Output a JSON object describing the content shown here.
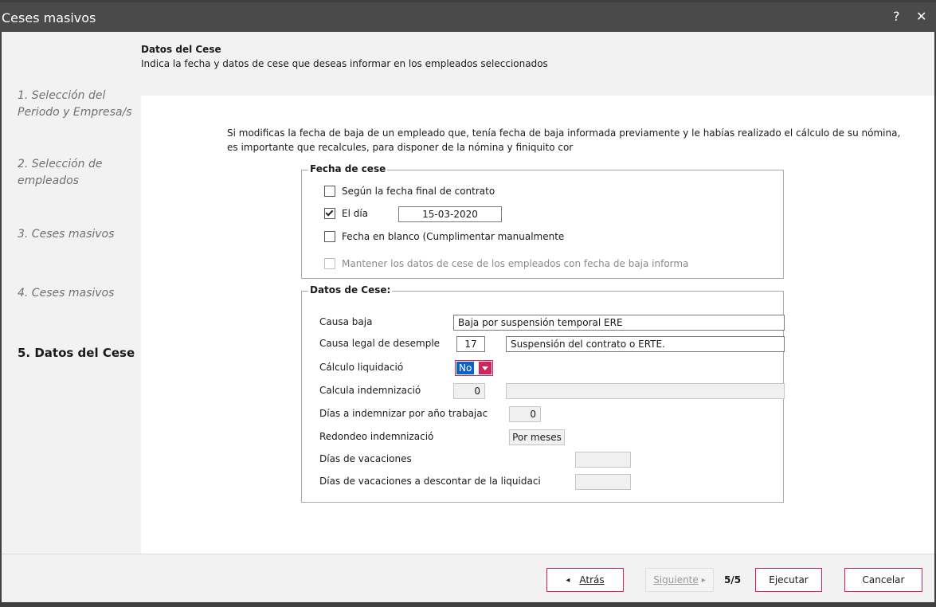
{
  "window": {
    "title": "Ceses masivos",
    "help_label": "?",
    "close_label": "✕"
  },
  "header": {
    "title": "Datos del Cese",
    "subtitle": "Indica la fecha y datos de cese que deseas informar en los empleados seleccionados"
  },
  "steps": [
    {
      "label": "1. Selección del Periodo y Empresa/s"
    },
    {
      "label": "2. Selección de empleados"
    },
    {
      "label": "3. Ceses masivos"
    },
    {
      "label": "4. Ceses masivos"
    },
    {
      "label": "5. Datos del Cese"
    }
  ],
  "info_text": "Si modificas la fecha de baja de un empleado que, tenía fecha de baja informada previamente y le habías realizado el cálculo de su nómina, es importante que recalcules, para disponer de la nómina y finiquito cor",
  "fecha_cese": {
    "legend": "Fecha de cese",
    "opt_contrato": "Según la fecha final de contrato",
    "opt_dia": "El día",
    "dia_value": "15-03-2020",
    "opt_blanco": "Fecha en blanco (Cumplimentar manualmente",
    "opt_mantener": "Mantener los datos de cese de los empleados con fecha de baja informa"
  },
  "datos_cese": {
    "legend": "Datos de Cese:",
    "causa_baja_label": "Causa baja",
    "causa_baja_value": "Baja por suspensión temporal ERE",
    "causa_legal_label": "Causa legal de desemple",
    "causa_legal_code": "17",
    "causa_legal_desc": "Suspensión del contrato o ERTE.",
    "calculo_label": "Cálculo liquidació",
    "calculo_value": "No",
    "indemnizacion_label": "Calcula indemnizació",
    "indemnizacion_value": "0",
    "indemnizacion_desc": "",
    "dias_anio_label": "Días a indemnizar por año trabajac",
    "dias_anio_value": "0",
    "redondeo_label": "Redondeo indemnizació",
    "redondeo_value": "Por meses",
    "vacaciones_label": "Días de vacaciones",
    "vacaciones_value": "",
    "vac_descontar_label": "Días de vacaciones a descontar de la liquidaci",
    "vac_descontar_value": ""
  },
  "footer": {
    "back_label": "Atrás",
    "back_arrow": "◂",
    "next_label": "Siguiente",
    "next_arrow": "▸",
    "page": "5/5",
    "execute_label": "Ejecutar",
    "cancel_label": "Cancelar"
  }
}
